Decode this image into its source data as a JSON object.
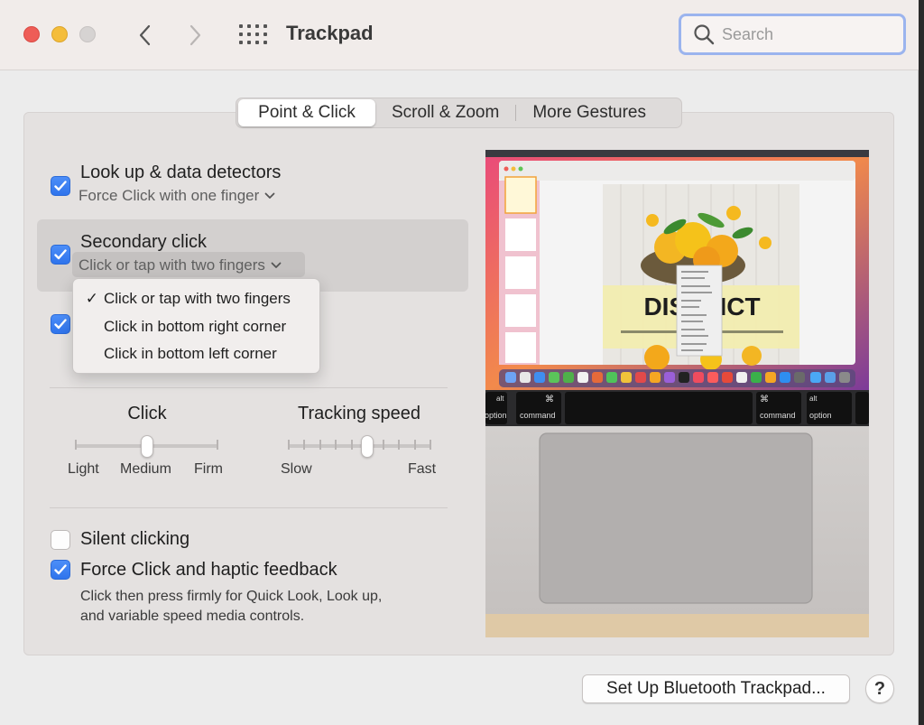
{
  "window": {
    "title": "Trackpad"
  },
  "search": {
    "placeholder": "Search",
    "value": ""
  },
  "tabs": [
    {
      "label": "Point & Click",
      "selected": true
    },
    {
      "label": "Scroll & Zoom",
      "selected": false
    },
    {
      "label": "More Gestures",
      "selected": false
    }
  ],
  "options": {
    "lookup": {
      "label": "Look up & data detectors",
      "checked": true,
      "sub": "Force Click with one finger"
    },
    "secondary": {
      "label": "Secondary click",
      "checked": true,
      "sub": "Click or tap with two fingers"
    },
    "third": {
      "checked": true
    }
  },
  "dropdown": {
    "selected": "Click or tap with two fingers",
    "check_glyph": "✓",
    "items": [
      "Click or tap with two fingers",
      "Click in bottom right corner",
      "Click in bottom left corner"
    ]
  },
  "sliders": {
    "click": {
      "title": "Click",
      "labels": [
        "Light",
        "Medium",
        "Firm"
      ],
      "value": "Medium"
    },
    "tracking": {
      "title": "Tracking speed",
      "min_label": "Slow",
      "max_label": "Fast",
      "steps": 10,
      "value_step": 6
    }
  },
  "silent_clicking": {
    "label": "Silent clicking",
    "checked": false
  },
  "force_click": {
    "label": "Force Click and haptic feedback",
    "checked": true,
    "description_line1": "Click then press firmly for Quick Look, Look up,",
    "description_line2": "and variable speed media controls."
  },
  "preview": {
    "document_heading": "DISTRICT",
    "keys": {
      "left_alt_symbol": "alt",
      "left_alt": "option",
      "left_cmd_symbol": "⌘",
      "left_cmd": "command",
      "right_cmd_symbol": "⌘",
      "right_cmd": "command",
      "right_alt_symbol": "alt",
      "right_alt": "option"
    }
  },
  "buttons": {
    "bluetooth": "Set Up Bluetooth Trackpad...",
    "help": "?"
  },
  "colors": {
    "accent": "#3b82f6",
    "search_focus": "#9bb4ee"
  }
}
